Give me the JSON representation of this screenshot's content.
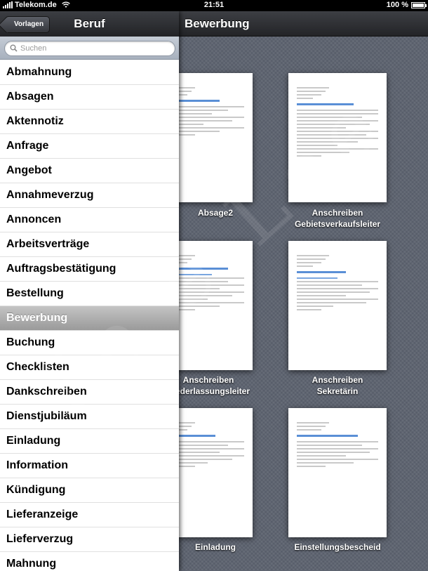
{
  "status": {
    "carrier": "Telekom.de",
    "time": "21:51",
    "battery": "100 %"
  },
  "popover": {
    "back_label": "Vorlagen",
    "title": "Beruf",
    "search_placeholder": "Suchen",
    "items": [
      "Abmahnung",
      "Absagen",
      "Aktennotiz",
      "Anfrage",
      "Angebot",
      "Annahmeverzug",
      "Annoncen",
      "Arbeitsverträge",
      "Auftragsbestätigung",
      "Bestellung",
      "Bewerbung",
      "Buchung",
      "Checklisten",
      "Dankschreiben",
      "Dienstjubiläum",
      "Einladung",
      "Information",
      "Kündigung",
      "Lieferanzeige",
      "Lieferverzug",
      "Mahnung"
    ],
    "selected_item": "Bewerbung"
  },
  "main": {
    "title": "Bewerbung",
    "documents": [
      {
        "label_line1": "Absage2",
        "label_line2": ""
      },
      {
        "label_line1": "Anschreiben",
        "label_line2": "Gebietsverkaufsleiter"
      },
      {
        "label_line1": "Anschreiben",
        "label_line2": "Niederlassungsleiter"
      },
      {
        "label_line1": "Anschreiben",
        "label_line2": "Sekretärin"
      },
      {
        "label_line1": "Einladung",
        "label_line2": ""
      },
      {
        "label_line1": "Einstellungsbescheid",
        "label_line2": ""
      }
    ]
  },
  "watermark": "Fe e Loe"
}
